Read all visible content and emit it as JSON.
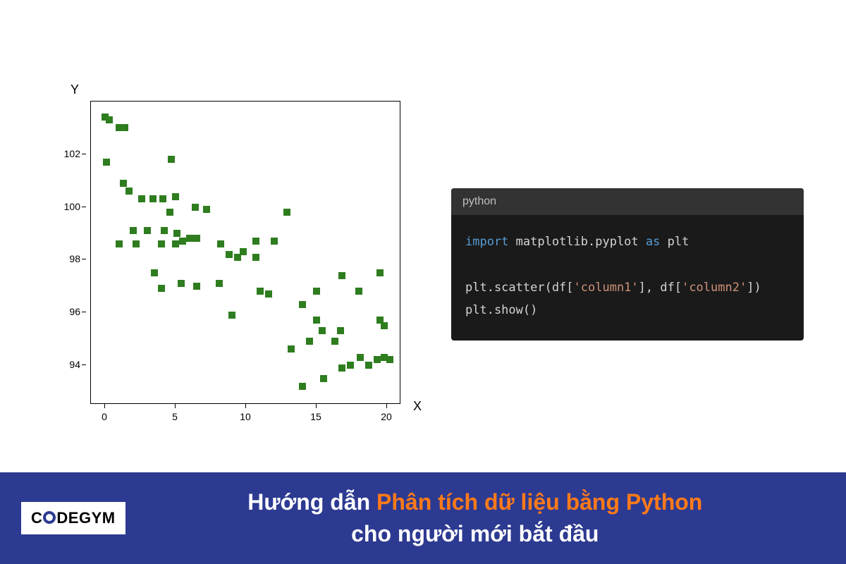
{
  "chart_data": {
    "type": "scatter",
    "xlabel": "X",
    "ylabel": "Y",
    "xlim": [
      -1,
      21
    ],
    "ylim": [
      92.5,
      104
    ],
    "x_ticks": [
      0,
      5,
      10,
      15,
      20
    ],
    "y_ticks": [
      94,
      96,
      98,
      100,
      102
    ],
    "marker_color": "#2e7d1f",
    "points": [
      {
        "x": 0.0,
        "y": 103.4
      },
      {
        "x": 0.3,
        "y": 103.3
      },
      {
        "x": 1.0,
        "y": 103.0
      },
      {
        "x": 1.4,
        "y": 103.0
      },
      {
        "x": 0.1,
        "y": 101.7
      },
      {
        "x": 1.3,
        "y": 100.9
      },
      {
        "x": 1.7,
        "y": 100.6
      },
      {
        "x": 4.7,
        "y": 101.8
      },
      {
        "x": 2.6,
        "y": 100.3
      },
      {
        "x": 3.4,
        "y": 100.3
      },
      {
        "x": 4.1,
        "y": 100.3
      },
      {
        "x": 5.0,
        "y": 100.4
      },
      {
        "x": 4.6,
        "y": 99.8
      },
      {
        "x": 6.4,
        "y": 100.0
      },
      {
        "x": 7.2,
        "y": 99.9
      },
      {
        "x": 2.0,
        "y": 99.1
      },
      {
        "x": 3.0,
        "y": 99.1
      },
      {
        "x": 4.2,
        "y": 99.1
      },
      {
        "x": 5.1,
        "y": 99.0
      },
      {
        "x": 6.0,
        "y": 98.8
      },
      {
        "x": 6.5,
        "y": 98.8
      },
      {
        "x": 1.0,
        "y": 98.6
      },
      {
        "x": 2.2,
        "y": 98.6
      },
      {
        "x": 4.0,
        "y": 98.6
      },
      {
        "x": 5.0,
        "y": 98.6
      },
      {
        "x": 5.5,
        "y": 98.7
      },
      {
        "x": 8.2,
        "y": 98.6
      },
      {
        "x": 8.8,
        "y": 98.2
      },
      {
        "x": 9.4,
        "y": 98.1
      },
      {
        "x": 9.8,
        "y": 98.3
      },
      {
        "x": 10.7,
        "y": 98.7
      },
      {
        "x": 10.7,
        "y": 98.1
      },
      {
        "x": 12.0,
        "y": 98.7
      },
      {
        "x": 3.5,
        "y": 97.5
      },
      {
        "x": 4.0,
        "y": 96.9
      },
      {
        "x": 5.4,
        "y": 97.1
      },
      {
        "x": 6.5,
        "y": 97.0
      },
      {
        "x": 12.9,
        "y": 99.8
      },
      {
        "x": 8.1,
        "y": 97.1
      },
      {
        "x": 9.0,
        "y": 95.9
      },
      {
        "x": 11.0,
        "y": 96.8
      },
      {
        "x": 11.6,
        "y": 96.7
      },
      {
        "x": 14.0,
        "y": 96.3
      },
      {
        "x": 15.0,
        "y": 96.8
      },
      {
        "x": 16.8,
        "y": 97.4
      },
      {
        "x": 18.0,
        "y": 96.8
      },
      {
        "x": 16.7,
        "y": 95.3
      },
      {
        "x": 15.0,
        "y": 95.7
      },
      {
        "x": 19.5,
        "y": 97.5
      },
      {
        "x": 14.5,
        "y": 94.9
      },
      {
        "x": 15.4,
        "y": 95.3
      },
      {
        "x": 16.3,
        "y": 94.9
      },
      {
        "x": 19.5,
        "y": 95.7
      },
      {
        "x": 19.8,
        "y": 95.5
      },
      {
        "x": 13.2,
        "y": 94.6
      },
      {
        "x": 14.0,
        "y": 93.2
      },
      {
        "x": 15.5,
        "y": 93.5
      },
      {
        "x": 16.8,
        "y": 93.9
      },
      {
        "x": 17.4,
        "y": 94.0
      },
      {
        "x": 18.1,
        "y": 94.3
      },
      {
        "x": 18.7,
        "y": 94.0
      },
      {
        "x": 19.3,
        "y": 94.2
      },
      {
        "x": 19.8,
        "y": 94.3
      },
      {
        "x": 20.2,
        "y": 94.2
      }
    ]
  },
  "code": {
    "header": "python",
    "line1_kw1": "import",
    "line1_mod": " matplotlib.pyplot ",
    "line1_kw2": "as",
    "line1_alias": " plt",
    "line2_a": "plt.scatter(df[",
    "line2_s1": "'column1'",
    "line2_b": "], df[",
    "line2_s2": "'column2'",
    "line2_c": "])",
    "line3": "plt.show()"
  },
  "banner": {
    "logo_part1": "C",
    "logo_part2": "DEGYM",
    "text_white1": "Hướng dẫn ",
    "text_orange": "Phân tích dữ liệu bằng Python",
    "text_white2": "cho người mới bắt đầu"
  }
}
